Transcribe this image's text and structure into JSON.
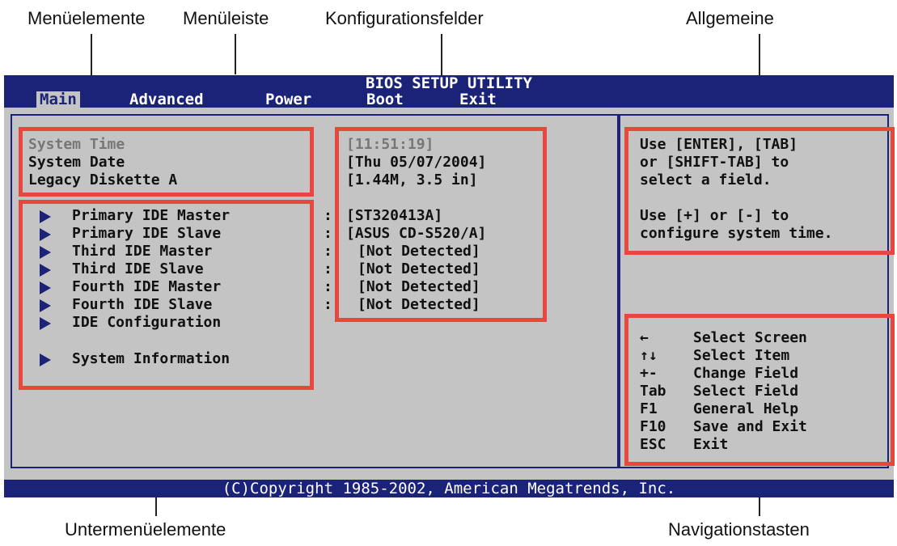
{
  "callouts": {
    "menu_items": "Menüelemente",
    "menu_bar": "Menüleiste",
    "config_fields": "Konfigurationsfelder",
    "general": "Allgemeine",
    "submenu_items": "Untermenüelemente",
    "nav_keys": "Navigationstasten"
  },
  "bios": {
    "title": "BIOS SETUP UTILITY",
    "tabs": [
      "Main",
      "Advanced",
      "Power",
      "Boot",
      "Exit"
    ],
    "active_tab": "Main",
    "footer": "(C)Copyright 1985-2002, American Megatrends, Inc.",
    "main_items": [
      {
        "label": "System Time",
        "value": "[11:51:19]"
      },
      {
        "label": "System Date",
        "value": "[Thu 05/07/2004]"
      },
      {
        "label": "Legacy Diskette A",
        "value": "[1.44M, 3.5 in]"
      }
    ],
    "submenu_items": [
      {
        "label": "Primary IDE Master",
        "sep": ":",
        "value": "[ST320413A]"
      },
      {
        "label": "Primary IDE Slave",
        "sep": ":",
        "value": "[ASUS CD-S520/A]"
      },
      {
        "label": "Third IDE Master",
        "sep": ":",
        "value": "[Not Detected]"
      },
      {
        "label": "Third IDE Slave",
        "sep": ":",
        "value": "[Not Detected]"
      },
      {
        "label": "Fourth IDE Master",
        "sep": ":",
        "value": "[Not Detected]"
      },
      {
        "label": "Fourth IDE Slave",
        "sep": ":",
        "value": "[Not Detected]"
      },
      {
        "label": "IDE Configuration",
        "sep": "",
        "value": ""
      },
      {
        "label": "System Information",
        "sep": "",
        "value": ""
      }
    ],
    "help": {
      "line1": "Use [ENTER], [TAB]",
      "line2": "or [SHIFT-TAB] to",
      "line3": "select a field.",
      "line4": "Use [+] or [-] to",
      "line5": "configure system time."
    },
    "nav": [
      {
        "key": "←",
        "desc": "Select Screen"
      },
      {
        "key": "↑↓",
        "desc": "Select Item"
      },
      {
        "key": "+-",
        "desc": "Change Field"
      },
      {
        "key": "Tab",
        "desc": "Select Field"
      },
      {
        "key": "F1",
        "desc": "General Help"
      },
      {
        "key": "F10",
        "desc": "Save and Exit"
      },
      {
        "key": "ESC",
        "desc": "Exit"
      }
    ]
  },
  "colors": {
    "bios_blue": "#1a2377",
    "bios_grey": "#c4c4c4",
    "highlight_red": "#e8473d"
  }
}
